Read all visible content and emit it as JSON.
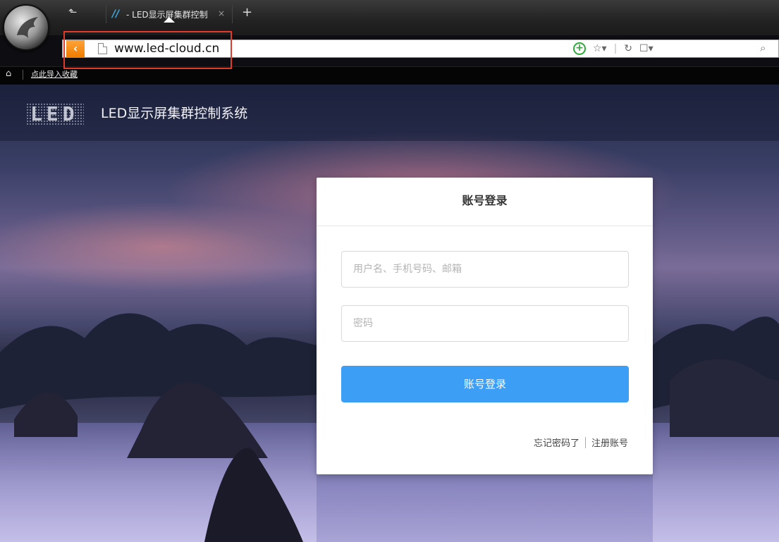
{
  "browser": {
    "tab_title": "- LED显示屏集群控制",
    "tab_close": "×",
    "new_tab": "+",
    "url": "www.led-cloud.cn",
    "bookmark_link": "点此导入收藏"
  },
  "header": {
    "logo_text": "LED",
    "site_title": "LED显示屏集群控制系统"
  },
  "login": {
    "title": "账号登录",
    "username_placeholder": "用户名、手机号码、邮箱",
    "password_placeholder": "密码",
    "submit_label": "账号登录",
    "forgot_label": "忘记密码了",
    "register_label": "注册账号"
  },
  "colors": {
    "accent": "#3d9ef5",
    "highlight_box": "#e23b2e"
  }
}
